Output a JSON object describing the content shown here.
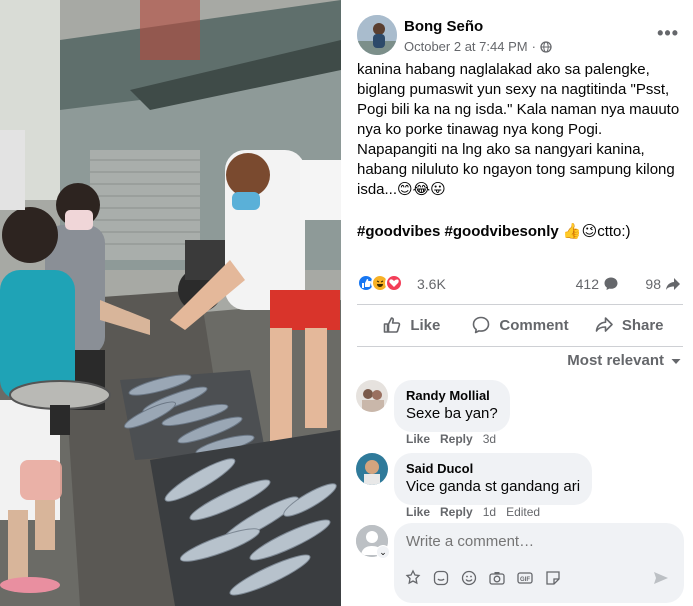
{
  "post": {
    "author": "Bong Seño",
    "timestamp": "October 2 at 7:44 PM",
    "privacy_icon": "globe-icon",
    "more_label": "•••",
    "body": "kanina habang naglalakad ako sa palengke, biglang pumaswit yun sexy na nagtitinda \"Psst, Pogi bili ka na ng isda.\" Kala naman nya mauuto nya ko porke tinawag nya kong Pogi. Napapangiti na lng ako sa nangyari kanina, habang niluluto ko ngayon tong sampung kilong isda...😊😂😛",
    "hashtag_1": "#goodvibes",
    "hashtag_2": "#goodvibesonly",
    "hashtag_tail": "👍😉ctto:)"
  },
  "stats": {
    "reactions": "3.6K",
    "comments": "412",
    "shares": "98",
    "reaction_types": [
      "like",
      "haha",
      "love"
    ]
  },
  "actions": {
    "like": "Like",
    "comment": "Comment",
    "share": "Share"
  },
  "sort": {
    "label": "Most relevant"
  },
  "comments": [
    {
      "name": "Randy Mollial",
      "text": "Sexe ba yan?",
      "like": "Like",
      "reply": "Reply",
      "age": "3d",
      "edited": ""
    },
    {
      "name": "Said Ducol",
      "text": "Vice ganda st gandang ari",
      "like": "Like",
      "reply": "Reply",
      "age": "1d",
      "edited": "Edited"
    }
  ],
  "composer": {
    "placeholder": "Write a comment…"
  },
  "colors": {
    "like_blue": "#1877f2",
    "love_red": "#f33e58",
    "haha_yellow": "#f7b125",
    "muted": "#65676b"
  }
}
